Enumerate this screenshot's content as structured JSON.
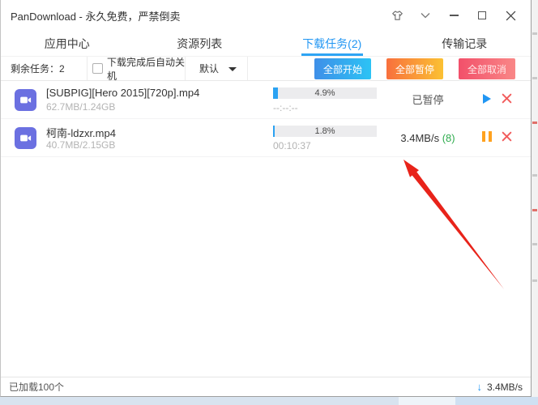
{
  "window": {
    "title": "PanDownload - 永久免费，严禁倒卖"
  },
  "tabs": [
    {
      "label": "应用中心",
      "active": false
    },
    {
      "label": "资源列表",
      "active": false
    },
    {
      "label": "下载任务(2)",
      "active": true
    },
    {
      "label": "传输记录",
      "active": false
    }
  ],
  "toolbar": {
    "remaining_tasks": "剩余任务：2",
    "auto_shutdown": "下载完成后自动关机",
    "mode": "默认",
    "start_all": "全部开始",
    "pause_all": "全部暂停",
    "cancel_all": "全部取消"
  },
  "downloads": [
    {
      "filename": "[SUBPIG][Hero 2015][720p].mp4",
      "size": "62.7MB/1.24GB",
      "percent": "4.9%",
      "progress_value": 4.9,
      "time": "--:--:--",
      "status": "已暂停"
    },
    {
      "filename": "柯南-ldzxr.mp4",
      "size": "40.7MB/2.15GB",
      "percent": "1.8%",
      "progress_value": 1.8,
      "time": "00:10:37",
      "speed": "3.4MB/s",
      "threads": "(8)"
    }
  ],
  "statusbar": {
    "loaded": "已加载100个",
    "speed": "3.4MB/s",
    "download_arrow": "↓"
  },
  "icons": {
    "theme": "shirt",
    "menu": "chevron-down",
    "video": "camcorder",
    "resume": "play-triangle",
    "pause": "double-bar",
    "remove": "red-x"
  },
  "colors": {
    "accent": "#2196f3",
    "progress_fill": "#2ba2f2",
    "start_gradient": [
      "#3f8fe8",
      "#2cc3f5"
    ],
    "pause_gradient": [
      "#f8703d",
      "#fbc133"
    ],
    "cancel_gradient": [
      "#f2506a",
      "#f98787"
    ],
    "threads_green": "#2fac4e",
    "file_icon_bg": "#6b70e1",
    "annotation_red": "#e8231a"
  }
}
